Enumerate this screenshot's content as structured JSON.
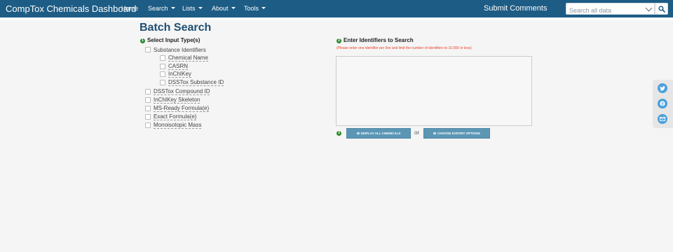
{
  "nav": {
    "brand": "CompTox Chemicals Dashboard",
    "items": [
      {
        "label": "Home",
        "dropdown": false
      },
      {
        "label": "Search",
        "dropdown": true
      },
      {
        "label": "Lists",
        "dropdown": true
      },
      {
        "label": "About",
        "dropdown": true
      },
      {
        "label": "Tools",
        "dropdown": true
      }
    ],
    "submit_comments": "Submit Comments",
    "search_placeholder": "Search all data",
    "search_icon": "search-icon"
  },
  "page": {
    "title": "Batch Search"
  },
  "input_types": {
    "step": "1",
    "label": "Select Input Type(s)",
    "substance_identifiers": {
      "label": "Substance Identifiers",
      "checked": false,
      "children": [
        {
          "label": "Chemical Name",
          "checked": false
        },
        {
          "label": "CASRN",
          "checked": false
        },
        {
          "label": "InChIKey",
          "checked": false
        },
        {
          "label": "DSSTox Substance ID",
          "checked": false
        }
      ]
    },
    "others": [
      {
        "label": "DSSTox Compound ID",
        "checked": false
      },
      {
        "label": "InChIKey Skeleton",
        "checked": false
      },
      {
        "label": "MS-Ready Formula(e)",
        "checked": false
      },
      {
        "label": "Exact Formula(e)",
        "checked": false
      },
      {
        "label": "Monoisotopic Mass",
        "checked": false
      }
    ]
  },
  "identifiers": {
    "step": "2",
    "label": "Enter Identifiers to Search",
    "hint": "(Please enter one identifier per line and limit the number of identifiers to 10,000 or less)",
    "value": ""
  },
  "actions": {
    "step": "3",
    "display_label": "DISPLAY ALL CHEMICALS",
    "or_text": "or",
    "export_label": "CHOOSE EXPORT OPTIONS"
  },
  "colors": {
    "navbar": "#1d5c85",
    "title": "#1f4f73",
    "step_badge": "#2e8b2e",
    "hint": "#e8412c",
    "action_button": "#5b97b5",
    "social_button": "#4aa0dc"
  },
  "social": [
    "twitter-icon",
    "facebook-icon",
    "email-icon"
  ]
}
